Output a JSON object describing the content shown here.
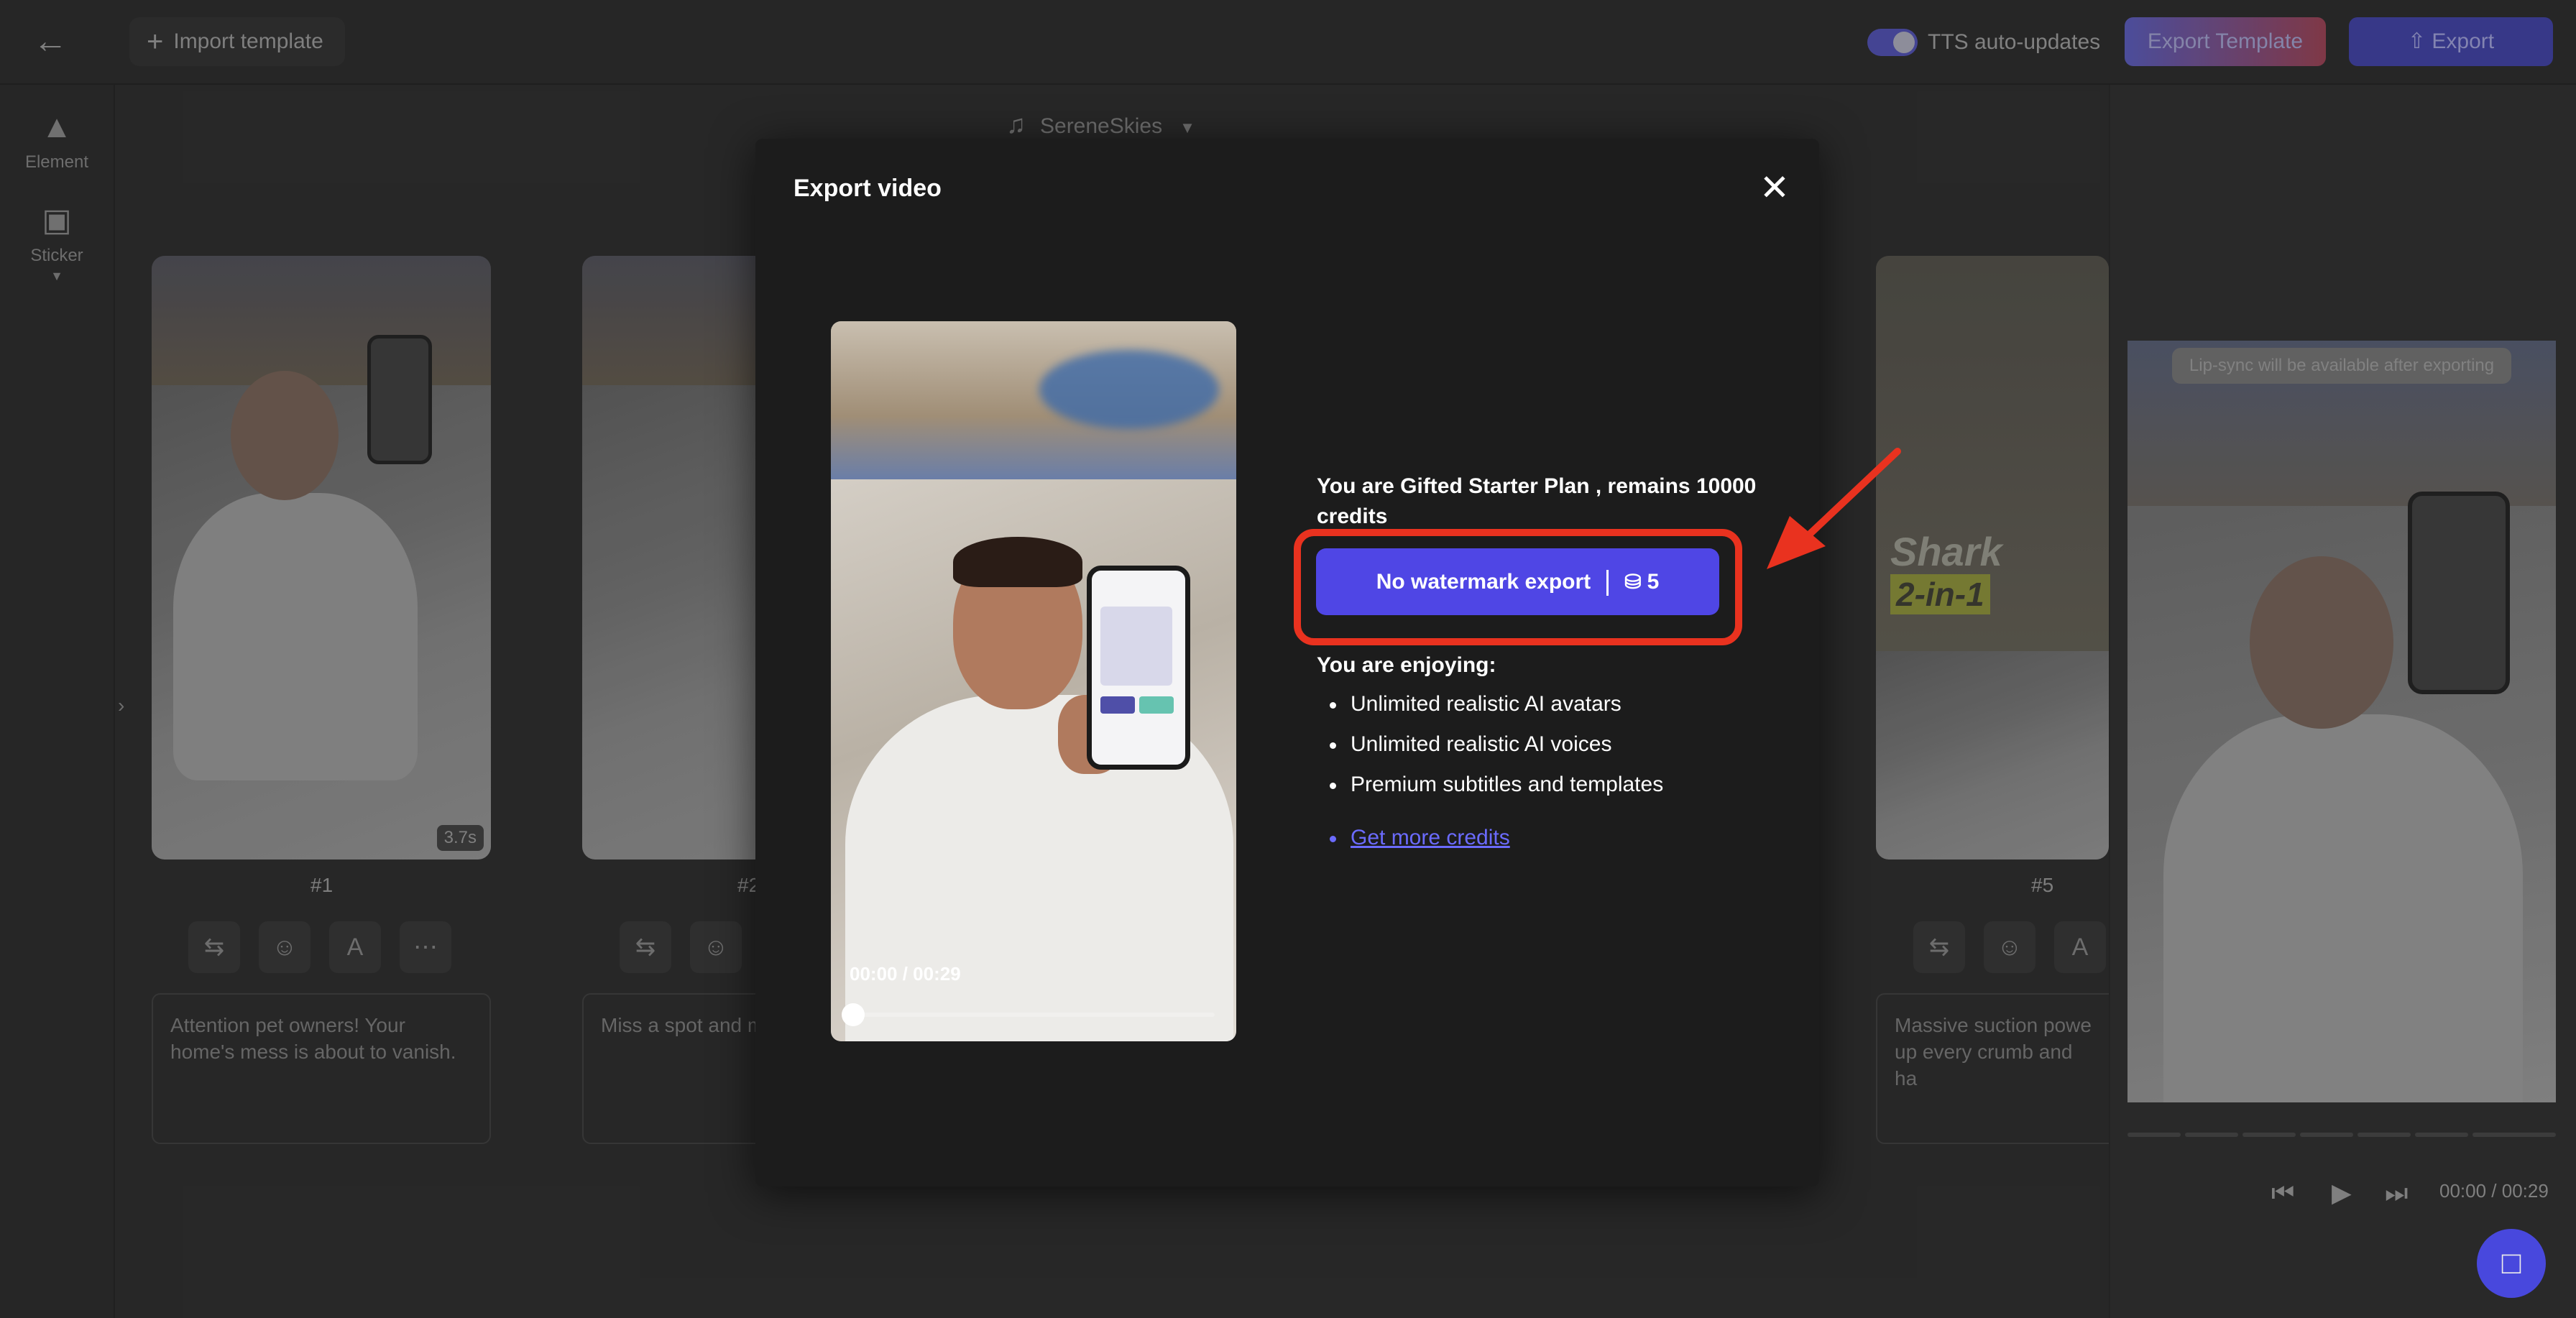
{
  "header": {
    "import_label": "Import template",
    "tts_label": "TTS auto-updates",
    "export_template_label": "Export Template",
    "export_label": "Export"
  },
  "sidebar": {
    "items": [
      {
        "label": "Element",
        "icon": "shapes-icon"
      },
      {
        "label": "Sticker",
        "icon": "sticker-icon"
      }
    ]
  },
  "music": {
    "track": "SereneSkies"
  },
  "scenes": [
    {
      "number": "#1",
      "duration": "3.7s",
      "caption": "Attention pet owners! Your home's mess is about to vanish."
    },
    {
      "number": "#2",
      "caption": "Miss a spot and multiply overnigh"
    },
    {
      "number": "#5",
      "caption": "Massive suction powe up every crumb and ha",
      "badge_line1": "Shark",
      "badge_line2": "2-in-1"
    }
  ],
  "preview": {
    "lipsync_notice": "Lip-sync will be available after exporting",
    "time": "00:00 / 00:29"
  },
  "modal": {
    "title": "Export video",
    "video_time": "00:00 / 00:29",
    "plan_text": "You are Gifted Starter Plan , remains 10000 credits",
    "export_button_label": "No watermark export",
    "export_cost": "5",
    "enjoying_label": "You are enjoying:",
    "features": [
      "Unlimited realistic AI avatars",
      "Unlimited realistic AI voices",
      "Premium subtitles and templates"
    ],
    "more_credits_link": "Get more credits"
  },
  "colors": {
    "accent": "#4f46e5",
    "highlight_red": "#e9321f",
    "link": "#6b6bff"
  }
}
